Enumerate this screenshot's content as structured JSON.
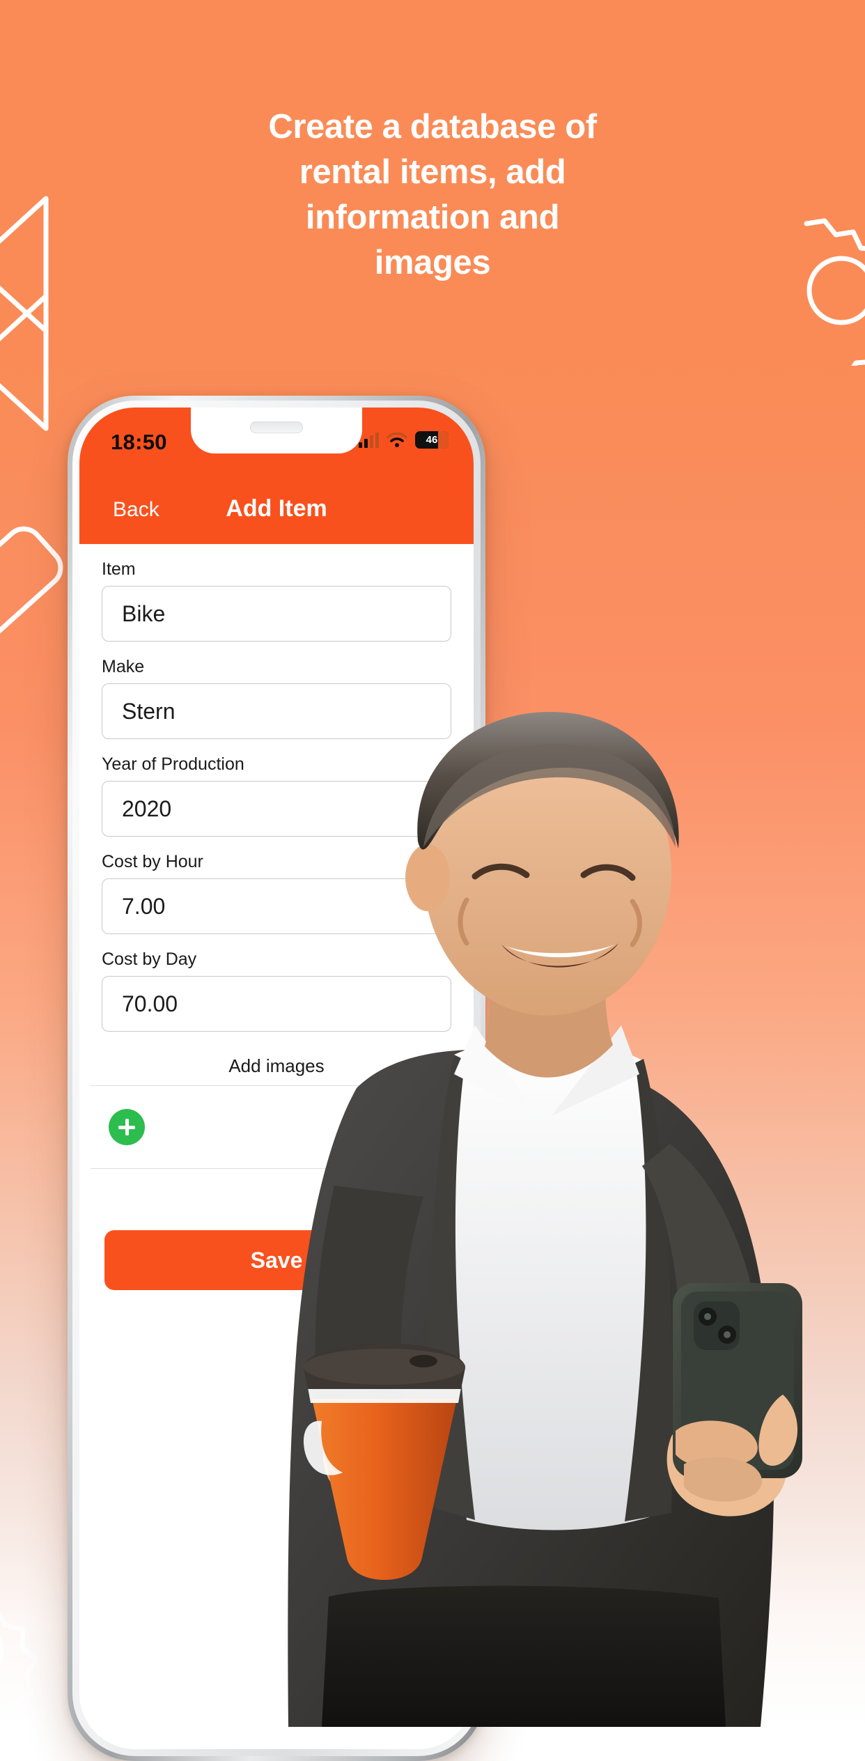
{
  "promo": {
    "headline": "Create a database of\nrental items, add\ninformation and\nimages",
    "background_top_color": "#fa8b56",
    "background_bottom_color": "#ffffff",
    "decorations": [
      "arrow-outline-icon",
      "gear-outline-icon",
      "rounded-rect-outline-icon",
      "gear-outline-bottom-icon"
    ]
  },
  "phone": {
    "status_bar": {
      "time": "18:50",
      "cellular_icon": "signal-bars-icon",
      "wifi_icon": "wifi-icon",
      "battery_icon": "battery-icon",
      "battery_level": "46"
    },
    "nav_bar": {
      "back_label": "Back",
      "title": "Add Item",
      "accent_color": "#f9511d"
    },
    "form": {
      "fields": [
        {
          "label": "Item",
          "value": "Bike"
        },
        {
          "label": "Make",
          "value": "Stern"
        },
        {
          "label": "Year of Production",
          "value": "2020"
        },
        {
          "label": "Cost by Hour",
          "value": "7.00"
        },
        {
          "label": "Cost by Day",
          "value": "70.00"
        }
      ],
      "add_images_label": "Add images",
      "add_image_button_icon": "plus-icon",
      "add_image_button_color": "#2dbd4e",
      "save_label": "Save",
      "save_button_color": "#f9511d"
    }
  }
}
